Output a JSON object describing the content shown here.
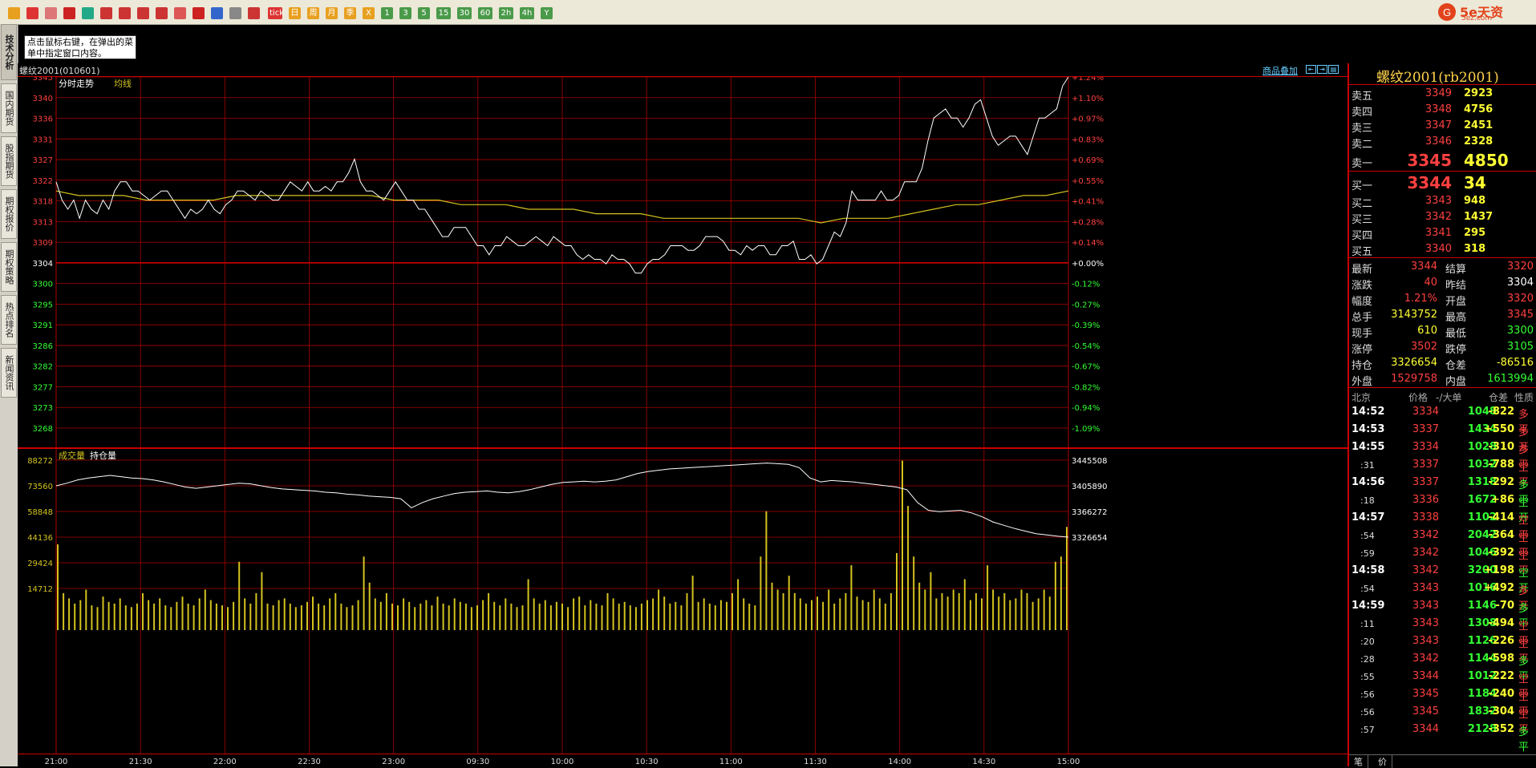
{
  "toolbar": {
    "buttons": [
      "back",
      "home",
      "news",
      "tv",
      "refresh",
      "search",
      "zoom",
      "window",
      "pen",
      "brush",
      "filter",
      "chart-add",
      "table",
      "trend"
    ],
    "keys": [
      "tick",
      "日",
      "周",
      "月",
      "季",
      "X",
      "1",
      "3",
      "5",
      "15",
      "30",
      "60",
      "2h",
      "4h",
      "Y"
    ],
    "brand_name": "5e天资",
    "brand_url": "5ez.com"
  },
  "left_tabs": [
    "技术分析",
    "国内期货",
    "股指期货",
    "期权报价",
    "期权策略",
    "热点排名",
    "新闻资讯"
  ],
  "tooltip": "点击鼠标右键，在弹出的菜单中指定窗口内容。",
  "chart_header": {
    "title": "螺纹2001(010601)",
    "link": "商品叠加"
  },
  "colors": {
    "up": "#ff4040",
    "down": "#33ff33",
    "grid": "#aa0000",
    "price_line": "#ffffff",
    "avg_line": "#d4c31e",
    "volume": "#d4c31e",
    "accent": "#ffd24a"
  },
  "chart_data": [
    {
      "type": "line",
      "legend": [
        "分时走势",
        "均线"
      ],
      "base_price": 3304,
      "y_ticks_left": [
        3345,
        3340,
        3336,
        3331,
        3327,
        3322,
        3318,
        3313,
        3309,
        3304,
        3300,
        3295,
        3291,
        3286,
        3282,
        3277,
        3273,
        3268
      ],
      "y_ticks_right": [
        "+1.24%",
        "+1.10%",
        "+0.97%",
        "+0.83%",
        "+0.69%",
        "+0.55%",
        "+0.41%",
        "+0.28%",
        "+0.14%",
        "+0.00%",
        "-0.12%",
        "-0.27%",
        "-0.39%",
        "-0.54%",
        "-0.67%",
        "-0.82%",
        "-0.94%",
        "-1.09%"
      ],
      "x_ticks": [
        "21:00",
        "21:30",
        "22:00",
        "22:30",
        "23:00",
        "09:30",
        "10:00",
        "10:30",
        "11:00",
        "11:30",
        "14:00",
        "14:30",
        "15:00"
      ],
      "series": [
        {
          "name": "分时走势",
          "values": [
            3322,
            3318,
            3316,
            3318,
            3314,
            3318,
            3316,
            3315,
            3318,
            3316,
            3320,
            3322,
            3322,
            3320,
            3320,
            3319,
            3318,
            3319,
            3320,
            3320,
            3318,
            3316,
            3314,
            3316,
            3315,
            3316,
            3318,
            3316,
            3315,
            3317,
            3318,
            3320,
            3320,
            3319,
            3318,
            3320,
            3319,
            3318,
            3318,
            3320,
            3322,
            3321,
            3320,
            3322,
            3320,
            3320,
            3321,
            3320,
            3322,
            3322,
            3324,
            3327,
            3322,
            3320,
            3320,
            3319,
            3318,
            3320,
            3322,
            3320,
            3318,
            3318,
            3316,
            3316,
            3314,
            3312,
            3310,
            3310,
            3312,
            3312,
            3312,
            3310,
            3308,
            3308,
            3306,
            3308,
            3308,
            3310,
            3309,
            3308,
            3308,
            3309,
            3310,
            3309,
            3308,
            3310,
            3309,
            3308,
            3308,
            3306,
            3305,
            3306,
            3305,
            3305,
            3304,
            3306,
            3305,
            3305,
            3304,
            3302,
            3302,
            3304,
            3305,
            3305,
            3306,
            3308,
            3308,
            3308,
            3307,
            3307,
            3308,
            3310,
            3310,
            3310,
            3309,
            3307,
            3307,
            3306,
            3308,
            3307,
            3308,
            3308,
            3306,
            3306,
            3308,
            3308,
            3309,
            3305,
            3305,
            3306,
            3304,
            3305,
            3308,
            3311,
            3310,
            3313,
            3320,
            3318,
            3318,
            3318,
            3318,
            3320,
            3318,
            3318,
            3319,
            3322,
            3322,
            3322,
            3325,
            3331,
            3336,
            3337,
            3338,
            3336,
            3336,
            3334,
            3336,
            3339,
            3340,
            3336,
            3332,
            3330,
            3331,
            3332,
            3332,
            3330,
            3328,
            3332,
            3336,
            3336,
            3337,
            3338,
            3343,
            3345
          ]
        },
        {
          "name": "均线",
          "values": [
            3320,
            3319,
            3319,
            3319,
            3318,
            3318,
            3318,
            3318,
            3319,
            3319,
            3319,
            3319,
            3319,
            3319,
            3319,
            3318,
            3318,
            3318,
            3317,
            3317,
            3317,
            3316,
            3316,
            3316,
            3315,
            3315,
            3315,
            3314,
            3314,
            3314,
            3314,
            3314,
            3314,
            3314,
            3313,
            3314,
            3314,
            3314,
            3315,
            3316,
            3317,
            3317,
            3318,
            3319,
            3319,
            3320
          ]
        }
      ]
    },
    {
      "type": "bar",
      "legend": [
        "成交量",
        "持仓量"
      ],
      "y_ticks_left": [
        88272,
        73560,
        58848,
        44136,
        29424,
        14712
      ],
      "y_ticks_right": [
        3445508,
        3405890,
        3366272,
        3326654
      ],
      "volume_max": 88272,
      "volume_values": [
        40000,
        12000,
        9000,
        6000,
        8000,
        14000,
        5000,
        4000,
        10000,
        7000,
        6000,
        9000,
        5000,
        4000,
        6000,
        12000,
        8000,
        6000,
        9000,
        5000,
        4000,
        7000,
        10000,
        6000,
        5000,
        9000,
        14000,
        8000,
        6000,
        5000,
        4000,
        7000,
        30000,
        9000,
        6000,
        12000,
        24000,
        6000,
        5000,
        8000,
        9000,
        6000,
        4000,
        5000,
        7000,
        10000,
        6000,
        5000,
        9000,
        12000,
        6000,
        4000,
        5000,
        8000,
        33000,
        18000,
        9000,
        7000,
        12000,
        6000,
        5000,
        9000,
        7000,
        4000,
        6000,
        8000,
        5000,
        10000,
        6000,
        5000,
        9000,
        7000,
        6000,
        4000,
        5000,
        8000,
        12000,
        7000,
        5000,
        9000,
        6000,
        4000,
        5000,
        20000,
        9000,
        6000,
        8000,
        5000,
        7000,
        6000,
        4000,
        9000,
        10000,
        5000,
        8000,
        6000,
        5000,
        12000,
        9000,
        6000,
        7000,
        5000,
        4000,
        6000,
        8000,
        9000,
        14000,
        10000,
        6000,
        7000,
        5000,
        12000,
        22000,
        7000,
        9000,
        6000,
        5000,
        8000,
        7000,
        12000,
        20000,
        9000,
        6000,
        5000,
        33000,
        59000,
        18000,
        14000,
        12000,
        22000,
        12000,
        9000,
        6000,
        8000,
        10000,
        7000,
        14000,
        6000,
        9000,
        12000,
        28000,
        10000,
        8000,
        7000,
        14000,
        9000,
        6000,
        12000,
        35000,
        88000,
        62000,
        33000,
        18000,
        14000,
        24000,
        9000,
        12000,
        10000,
        14000,
        12000,
        20000,
        8000,
        12000,
        9000,
        28000,
        14000,
        10000,
        12000,
        8000,
        9000,
        14000,
        12000,
        7000,
        9000,
        14000,
        10000,
        30000,
        33000,
        50000
      ],
      "oi_values": [
        3405890,
        3410000,
        3415000,
        3418000,
        3420000,
        3422000,
        3420000,
        3418000,
        3417000,
        3415000,
        3412000,
        3408000,
        3404000,
        3402000,
        3404000,
        3406000,
        3408000,
        3410000,
        3409000,
        3406000,
        3403000,
        3401000,
        3400000,
        3399000,
        3398000,
        3396000,
        3395000,
        3393000,
        3392000,
        3390000,
        3389000,
        3388000,
        3386000,
        3372000,
        3380000,
        3386000,
        3390000,
        3394000,
        3396000,
        3397000,
        3398000,
        3396000,
        3395000,
        3397000,
        3400000,
        3404000,
        3408000,
        3411000,
        3412000,
        3413000,
        3412000,
        3413000,
        3415000,
        3420000,
        3425000,
        3428000,
        3430000,
        3432000,
        3433000,
        3434000,
        3435000,
        3436000,
        3437000,
        3438000,
        3439000,
        3440000,
        3441000,
        3440000,
        3439000,
        3434000,
        3418000,
        3412000,
        3414000,
        3413000,
        3412000,
        3410000,
        3408000,
        3406000,
        3404000,
        3400000,
        3380000,
        3368000,
        3366000,
        3367000,
        3368000,
        3364000,
        3358000,
        3350000,
        3345000,
        3340000,
        3336000,
        3332000,
        3330000,
        3328000,
        3326654
      ]
    }
  ],
  "quote": {
    "title": "螺纹2001(rb2001)",
    "asks": [
      {
        "label": "卖五",
        "price": "3349",
        "vol": "2923"
      },
      {
        "label": "卖四",
        "price": "3348",
        "vol": "4756"
      },
      {
        "label": "卖三",
        "price": "3347",
        "vol": "2451"
      },
      {
        "label": "卖二",
        "price": "3346",
        "vol": "2328"
      },
      {
        "label": "卖一",
        "price": "3345",
        "vol": "4850"
      }
    ],
    "bids": [
      {
        "label": "买一",
        "price": "3344",
        "vol": "34"
      },
      {
        "label": "买二",
        "price": "3343",
        "vol": "948"
      },
      {
        "label": "买三",
        "price": "3342",
        "vol": "1437"
      },
      {
        "label": "买四",
        "price": "3341",
        "vol": "295"
      },
      {
        "label": "买五",
        "price": "3340",
        "vol": "318"
      }
    ],
    "stats": [
      {
        "l1": "最新",
        "v1": "3344",
        "c1": "#ff4040",
        "l2": "结算",
        "v2": "3320",
        "c2": "#ff4040"
      },
      {
        "l1": "涨跌",
        "v1": "40",
        "c1": "#ff4040",
        "l2": "昨结",
        "v2": "3304",
        "c2": "#ffffff"
      },
      {
        "l1": "幅度",
        "v1": "1.21%",
        "c1": "#ff4040",
        "l2": "开盘",
        "v2": "3320",
        "c2": "#ff4040"
      },
      {
        "l1": "总手",
        "v1": "3143752",
        "c1": "#ffff33",
        "l2": "最高",
        "v2": "3345",
        "c2": "#ff4040"
      },
      {
        "l1": "现手",
        "v1": "610",
        "c1": "#ffff33",
        "l2": "最低",
        "v2": "3300",
        "c2": "#33ff33"
      },
      {
        "l1": "涨停",
        "v1": "3502",
        "c1": "#ff4040",
        "l2": "跌停",
        "v2": "3105",
        "c2": "#33ff33"
      },
      {
        "l1": "持仓",
        "v1": "3326654",
        "c1": "#ffff33",
        "l2": "仓差",
        "v2": "-86516",
        "c2": "#ffff33"
      },
      {
        "l1": "外盘",
        "v1": "1529758",
        "c1": "#ff4040",
        "l2": "内盘",
        "v2": "1613994",
        "c2": "#33ff33"
      }
    ],
    "ticks_header": {
      "time": "北京",
      "price": "价格",
      "vol": "-/大单",
      "oi": "仓差",
      "type": "性质"
    },
    "ticks": [
      {
        "t": "14:52",
        "sub": false,
        "p": "3334",
        "v": "1048",
        "oi": "-822",
        "oic": "#ffff33",
        "ty": "多平",
        "tyc": "#ff4040"
      },
      {
        "t": "14:53",
        "sub": false,
        "p": "3337",
        "v": "1434",
        "oi": "+550",
        "oic": "#ffff33",
        "ty": "多开",
        "tyc": "#ff4040"
      },
      {
        "t": "14:55",
        "sub": false,
        "p": "3334",
        "v": "1028",
        "oi": "-310",
        "oic": "#ffff33",
        "ty": "多平",
        "tyc": "#ff4040"
      },
      {
        "t": ":31",
        "sub": true,
        "p": "3337",
        "v": "1032",
        "oi": "-788",
        "oic": "#ffff33",
        "ty": "空平",
        "tyc": "#ff4040"
      },
      {
        "t": "14:56",
        "sub": false,
        "p": "3337",
        "v": "1318",
        "oi": "-292",
        "oic": "#ffff33",
        "ty": "多平",
        "tyc": "#33ff33"
      },
      {
        "t": ":18",
        "sub": true,
        "p": "3336",
        "v": "1672",
        "oi": "+86",
        "oic": "#ffff33",
        "ty": "空开",
        "tyc": "#33ff33"
      },
      {
        "t": "14:57",
        "sub": false,
        "p": "3338",
        "v": "1102",
        "oi": "-414",
        "oic": "#ffff33",
        "ty": "空平",
        "tyc": "#ff4040"
      },
      {
        "t": ":54",
        "sub": true,
        "p": "3342",
        "v": "2042",
        "oi": "-364",
        "oic": "#ffff33",
        "ty": "空平",
        "tyc": "#ff4040"
      },
      {
        "t": ":59",
        "sub": true,
        "p": "3342",
        "v": "1046",
        "oi": "-392",
        "oic": "#ffff33",
        "ty": "空平",
        "tyc": "#ff4040"
      },
      {
        "t": "14:58",
        "sub": false,
        "p": "3342",
        "v": "3200",
        "oi": "+198",
        "oic": "#ffff33",
        "ty": "空开",
        "tyc": "#33ff33"
      },
      {
        "t": ":54",
        "sub": true,
        "p": "3343",
        "v": "1016",
        "oi": "+492",
        "oic": "#ffff33",
        "ty": "多开",
        "tyc": "#ff4040"
      },
      {
        "t": "14:59",
        "sub": false,
        "p": "3343",
        "v": "1146",
        "oi": "-70",
        "oic": "#ffff33",
        "ty": "多平",
        "tyc": "#33ff33"
      },
      {
        "t": ":11",
        "sub": true,
        "p": "3343",
        "v": "1308",
        "oi": "-494",
        "oic": "#ffff33",
        "ty": "空平",
        "tyc": "#ff4040"
      },
      {
        "t": ":20",
        "sub": true,
        "p": "3343",
        "v": "1126",
        "oi": "-226",
        "oic": "#ffff33",
        "ty": "空平",
        "tyc": "#ff4040"
      },
      {
        "t": ":28",
        "sub": true,
        "p": "3342",
        "v": "1144",
        "oi": "-598",
        "oic": "#ffff33",
        "ty": "多平",
        "tyc": "#33ff33"
      },
      {
        "t": ":55",
        "sub": true,
        "p": "3344",
        "v": "1012",
        "oi": "-222",
        "oic": "#ffff33",
        "ty": "空平",
        "tyc": "#ff4040"
      },
      {
        "t": ":56",
        "sub": true,
        "p": "3345",
        "v": "1184",
        "oi": "-240",
        "oic": "#ffff33",
        "ty": "空平",
        "tyc": "#ff4040"
      },
      {
        "t": ":56",
        "sub": true,
        "p": "3345",
        "v": "1832",
        "oi": "-304",
        "oic": "#ffff33",
        "ty": "空平",
        "tyc": "#ff4040"
      },
      {
        "t": ":57",
        "sub": true,
        "p": "3344",
        "v": "2128",
        "oi": "-352",
        "oic": "#ffff33",
        "ty": "多平",
        "tyc": "#33ff33"
      }
    ],
    "tabs": [
      "笔",
      "价"
    ]
  }
}
